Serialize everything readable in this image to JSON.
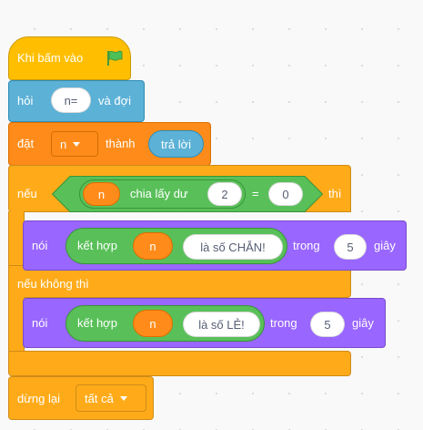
{
  "script": {
    "hat": {
      "label": "Khi bấm vào",
      "icon": "green-flag-icon"
    },
    "ask": {
      "label": "hỏi",
      "question": "n=",
      "suffix": "và đợi"
    },
    "set": {
      "label": "đặt",
      "variable": "n",
      "to_label": "thành",
      "reporter": "trả lời"
    },
    "if_else": {
      "if_label": "nếu",
      "then_label": "thì",
      "else_label": "nếu không thì",
      "condition": {
        "left": {
          "variable": "n",
          "op_label": "chia lấy dư",
          "divisor": "2"
        },
        "equals": "=",
        "right": "0"
      },
      "then_say": {
        "label": "nói",
        "join_label": "kết hợp",
        "variable": "n",
        "text": "là số CHẴN!",
        "for_label": "trong",
        "seconds": "5",
        "unit": "giây"
      },
      "else_say": {
        "label": "nói",
        "join_label": "kết hợp",
        "variable": "n",
        "text": "là số LẺ!",
        "for_label": "trong",
        "seconds": "5",
        "unit": "giây"
      }
    },
    "stop": {
      "label": "dừng lại",
      "option": "tất cả"
    }
  },
  "colors": {
    "events": "#ffbf00",
    "sensing": "#5cb1d6",
    "variables": "#ff8c1a",
    "control": "#ffab19",
    "looks": "#9966ff",
    "operators": "#59c059",
    "flag": "#4cbf56"
  }
}
